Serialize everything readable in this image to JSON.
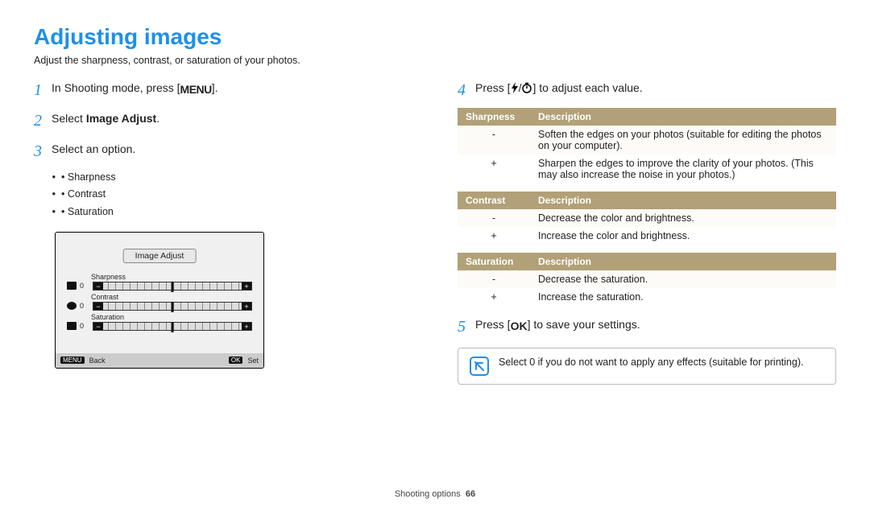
{
  "title": "Adjusting images",
  "subtitle": "Adjust the sharpness, contrast, or saturation of your photos.",
  "left": {
    "step1_pre": "In Shooting mode, press [",
    "step1_btn": "MENU",
    "step1_post": "].",
    "step2_pre": "Select ",
    "step2_bold": "Image Adjust",
    "step2_post": ".",
    "step3": "Select an option.",
    "bullets": {
      "a": "Sharpness",
      "b": "Contrast",
      "c": "Saturation"
    },
    "screen": {
      "title": "Image Adjust",
      "r0": {
        "label": "Sharpness",
        "val": "0"
      },
      "r1": {
        "label": "Contrast",
        "val": "0"
      },
      "r2": {
        "label": "Saturation",
        "val": "0"
      },
      "back_key": "MENU",
      "back": "Back",
      "set_key": "OK",
      "set": "Set"
    }
  },
  "right": {
    "step4_pre": "Press [",
    "step4_mid": "/",
    "step4_post": "] to adjust each value.",
    "tables": {
      "t0": {
        "h0": "Sharpness",
        "h1": "Description",
        "r0s": "-",
        "r0d": "Soften the edges on your photos (suitable for editing the photos on your computer).",
        "r1s": "+",
        "r1d": "Sharpen the edges to improve the clarity of your photos. (This may also increase the noise in your photos.)"
      },
      "t1": {
        "h0": "Contrast",
        "h1": "Description",
        "r0s": "-",
        "r0d": "Decrease the color and brightness.",
        "r1s": "+",
        "r1d": "Increase the color and brightness."
      },
      "t2": {
        "h0": "Saturation",
        "h1": "Description",
        "r0s": "-",
        "r0d": "Decrease the saturation.",
        "r1s": "+",
        "r1d": "Increase the saturation."
      }
    },
    "step5_pre": "Press [",
    "step5_btn": "OK",
    "step5_post": "] to save your settings.",
    "note": "Select 0 if you do not want to apply any effects (suitable for printing)."
  },
  "footer": {
    "section": "Shooting options",
    "page": "66"
  }
}
